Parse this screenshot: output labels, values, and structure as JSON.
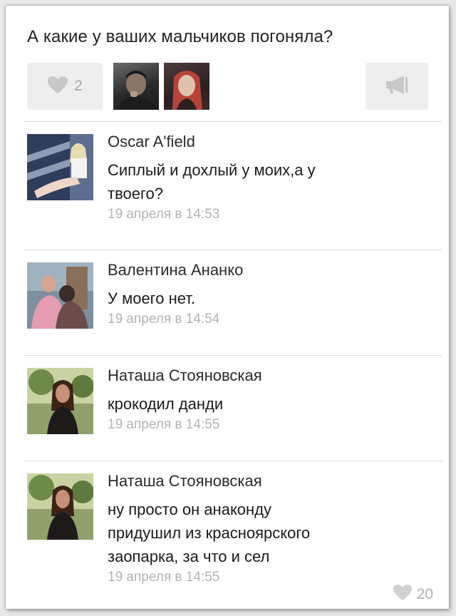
{
  "post": {
    "title": "А какие у ваших мальчиков погоняла?",
    "like_count": "2",
    "likers": [
      "liker-avatar-1",
      "liker-avatar-2"
    ]
  },
  "icons": {
    "like": "heart-icon",
    "share": "megaphone-icon"
  },
  "colors": {
    "background": "#ffffff",
    "button_bg": "#eeeeee",
    "icon_gray": "#c8c8c8",
    "meta_text": "#b3b3b3",
    "divider": "#d8d8d8"
  },
  "comments": [
    {
      "author": "Oscar A'field",
      "text_lines": [
        "Сиплый и дохлый у моих,а у",
        "твоего?"
      ],
      "time": "19 апреля в 14:53"
    },
    {
      "author": "Валентина Ананко",
      "text_lines": [
        "У моего нет."
      ],
      "time": "19 апреля в 14:54"
    },
    {
      "author": "Наташа Стояновская",
      "text_lines": [
        "крокодил данди"
      ],
      "time": "19 апреля в 14:55"
    },
    {
      "author": "Наташа Стояновская",
      "text_lines": [
        "ну просто он анаконду",
        "придушил из красноярского",
        "заопарка, за что и сел"
      ],
      "time": "19 апреля в 14:55",
      "like_count": "20"
    }
  ]
}
